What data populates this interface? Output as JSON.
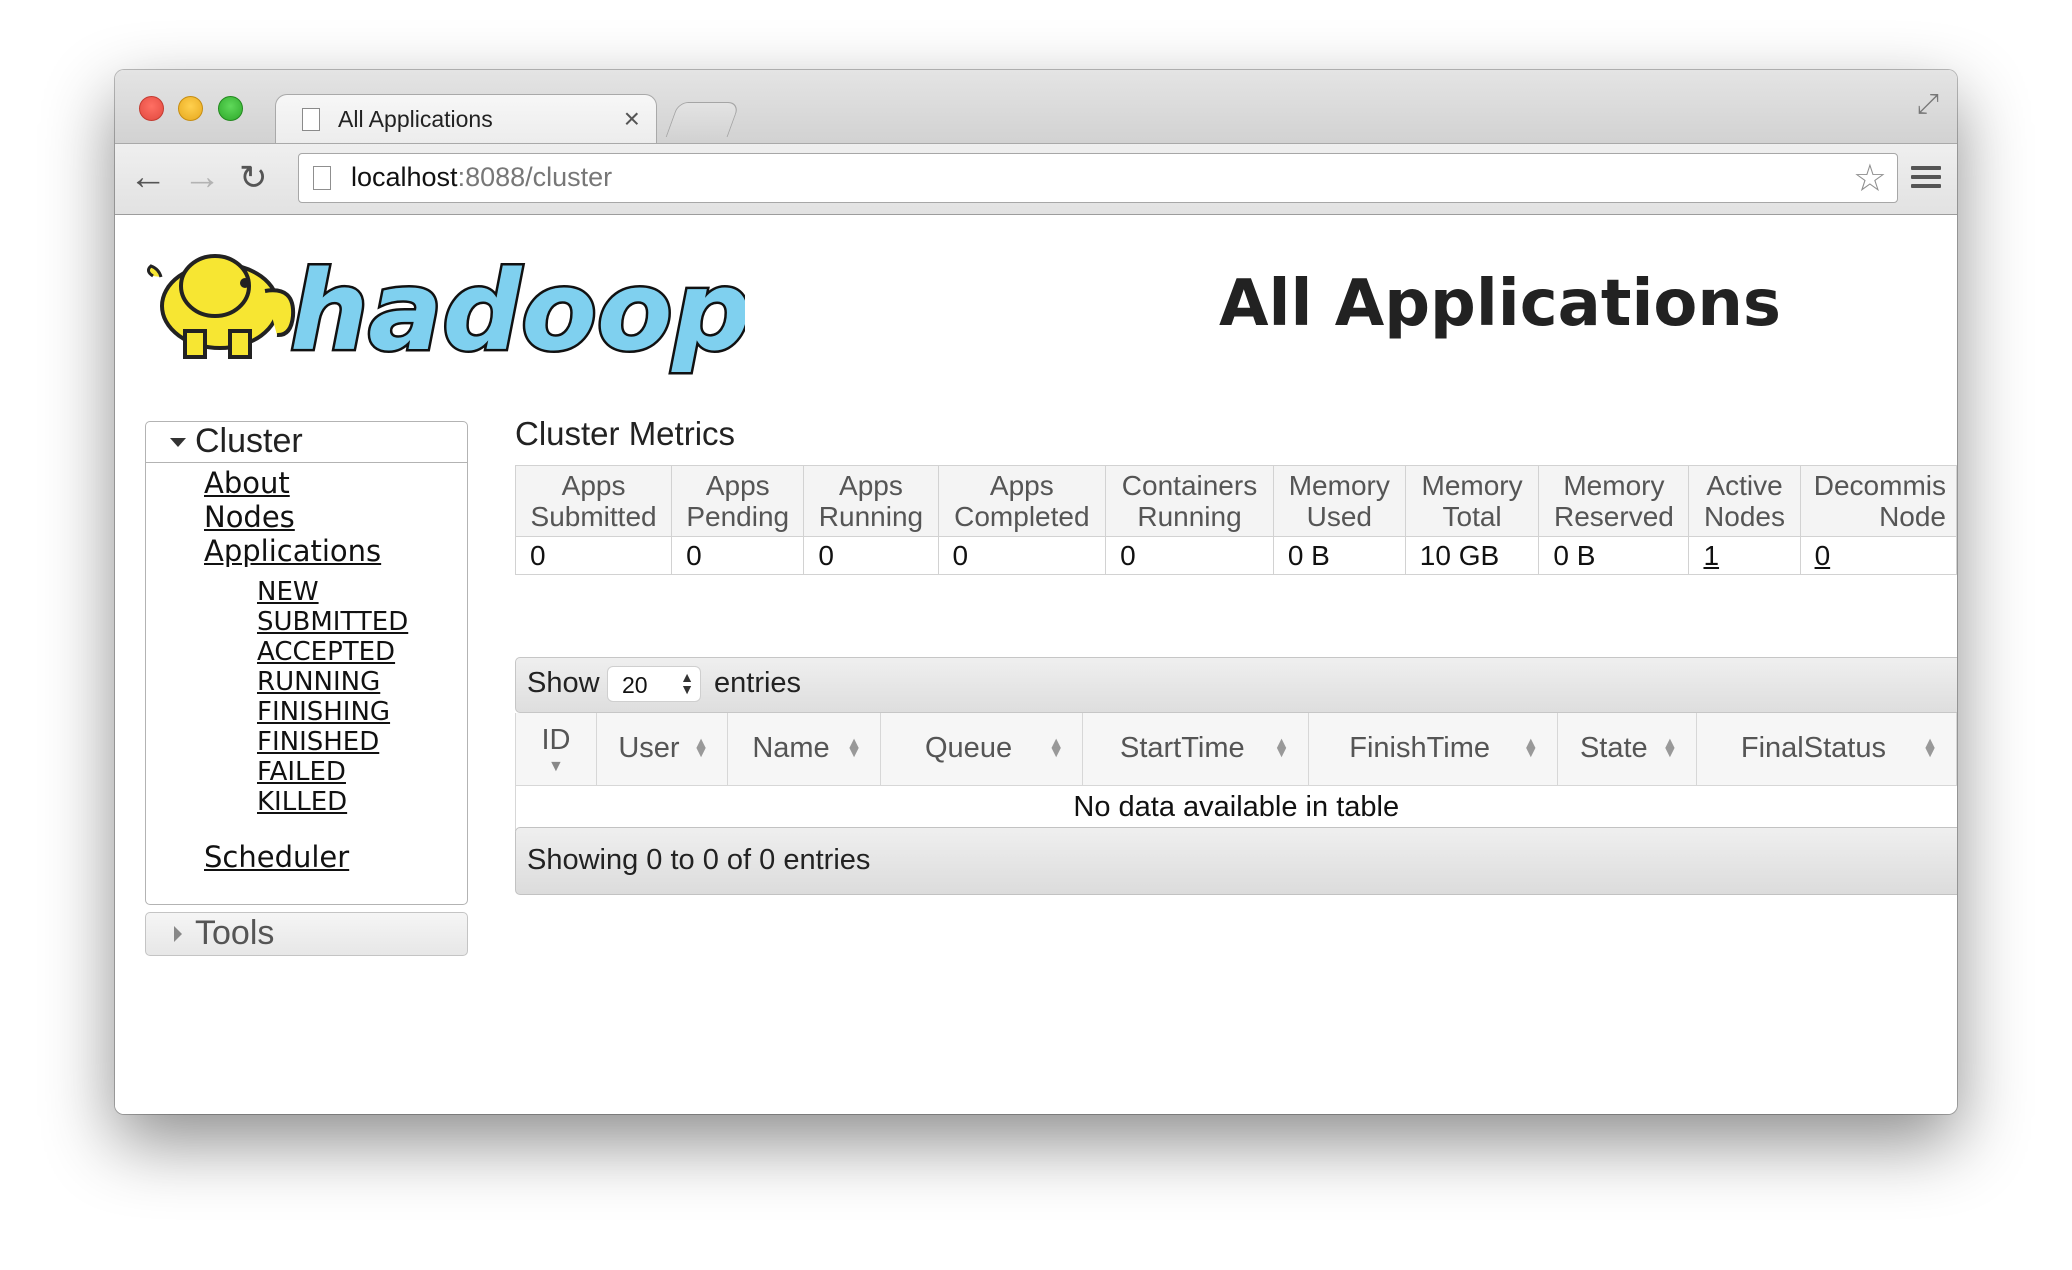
{
  "browser": {
    "tab_title": "All Applications",
    "tab_close": "×",
    "url_host": "localhost",
    "url_rest": ":8088/cluster"
  },
  "page": {
    "logo_text": "hadoop",
    "title": "All Applications"
  },
  "sidebar": {
    "cluster_label": "Cluster",
    "links": [
      "About",
      "Nodes",
      "Applications"
    ],
    "app_states": [
      "NEW",
      "SUBMITTED",
      "ACCEPTED",
      "RUNNING",
      "FINISHING",
      "FINISHED",
      "FAILED",
      "KILLED"
    ],
    "scheduler_label": "Scheduler",
    "tools_label": "Tools"
  },
  "metrics": {
    "title": "Cluster Metrics",
    "headers": [
      [
        "Apps",
        "Submitted"
      ],
      [
        "Apps",
        "Pending"
      ],
      [
        "Apps",
        "Running"
      ],
      [
        "Apps",
        "Completed"
      ],
      [
        "Containers",
        "Running"
      ],
      [
        "Memory",
        "Used"
      ],
      [
        "Memory",
        "Total"
      ],
      [
        "Memory",
        "Reserved"
      ],
      [
        "Active",
        "Nodes"
      ],
      [
        "Decommis",
        "Node"
      ]
    ],
    "values": [
      "0",
      "0",
      "0",
      "0",
      "0",
      "0 B",
      "10 GB",
      "0 B",
      "1",
      "0"
    ]
  },
  "datatable": {
    "show_label": "Show",
    "entries_value": "20",
    "entries_label": "entries",
    "columns": [
      "ID",
      "User",
      "Name",
      "Queue",
      "StartTime",
      "FinishTime",
      "State",
      "FinalStatus"
    ],
    "empty_message": "No data available in table",
    "info": "Showing 0 to 0 of 0 entries"
  }
}
